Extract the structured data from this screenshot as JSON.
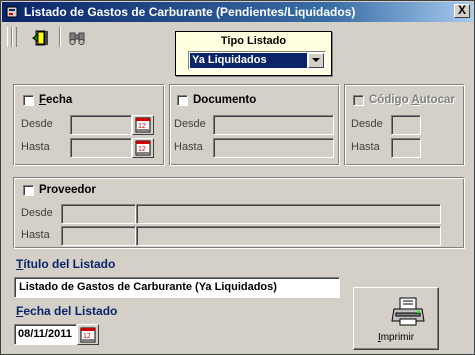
{
  "window": {
    "title": "Listado de Gastos de Carburante (Pendientes/Liquidados)",
    "close_label": "X"
  },
  "toolbar": {
    "exit_icon": "exit-door-icon",
    "binoculars_icon": "binoculars-icon"
  },
  "tipo_listado": {
    "label": "Tipo Listado",
    "selected": "Ya Liquidados"
  },
  "fecha": {
    "label_u": "F",
    "label_rest": "echa",
    "checked": false,
    "desde_label": "Desde",
    "hasta_label": "Hasta",
    "desde_value": "",
    "hasta_value": ""
  },
  "documento": {
    "label": "Documento",
    "checked": false,
    "desde_label": "Desde",
    "hasta_label": "Hasta"
  },
  "codigo_autocar": {
    "label_pre": "Código ",
    "label_u": "A",
    "label_rest": "utocar",
    "disabled": true,
    "desde_label": "Desde",
    "hasta_label": "Hasta"
  },
  "proveedor": {
    "label": "Proveedor",
    "checked": false,
    "desde_label": "Desde",
    "hasta_label": "Hasta"
  },
  "titulo": {
    "label_u": "T",
    "label_rest": "ítulo del Listado",
    "value": "Listado de Gastos de Carburante (Ya Liquidados)"
  },
  "fecha_listado": {
    "label_u": "F",
    "label_rest": "echa del Listado",
    "value": "08/11/2011"
  },
  "print_button": {
    "label_u": "I",
    "label_rest": "mprimir"
  },
  "colors": {
    "title_bar": "#0a246a",
    "face": "#d4d0c8",
    "tooltip_bg": "#ffffe1"
  }
}
